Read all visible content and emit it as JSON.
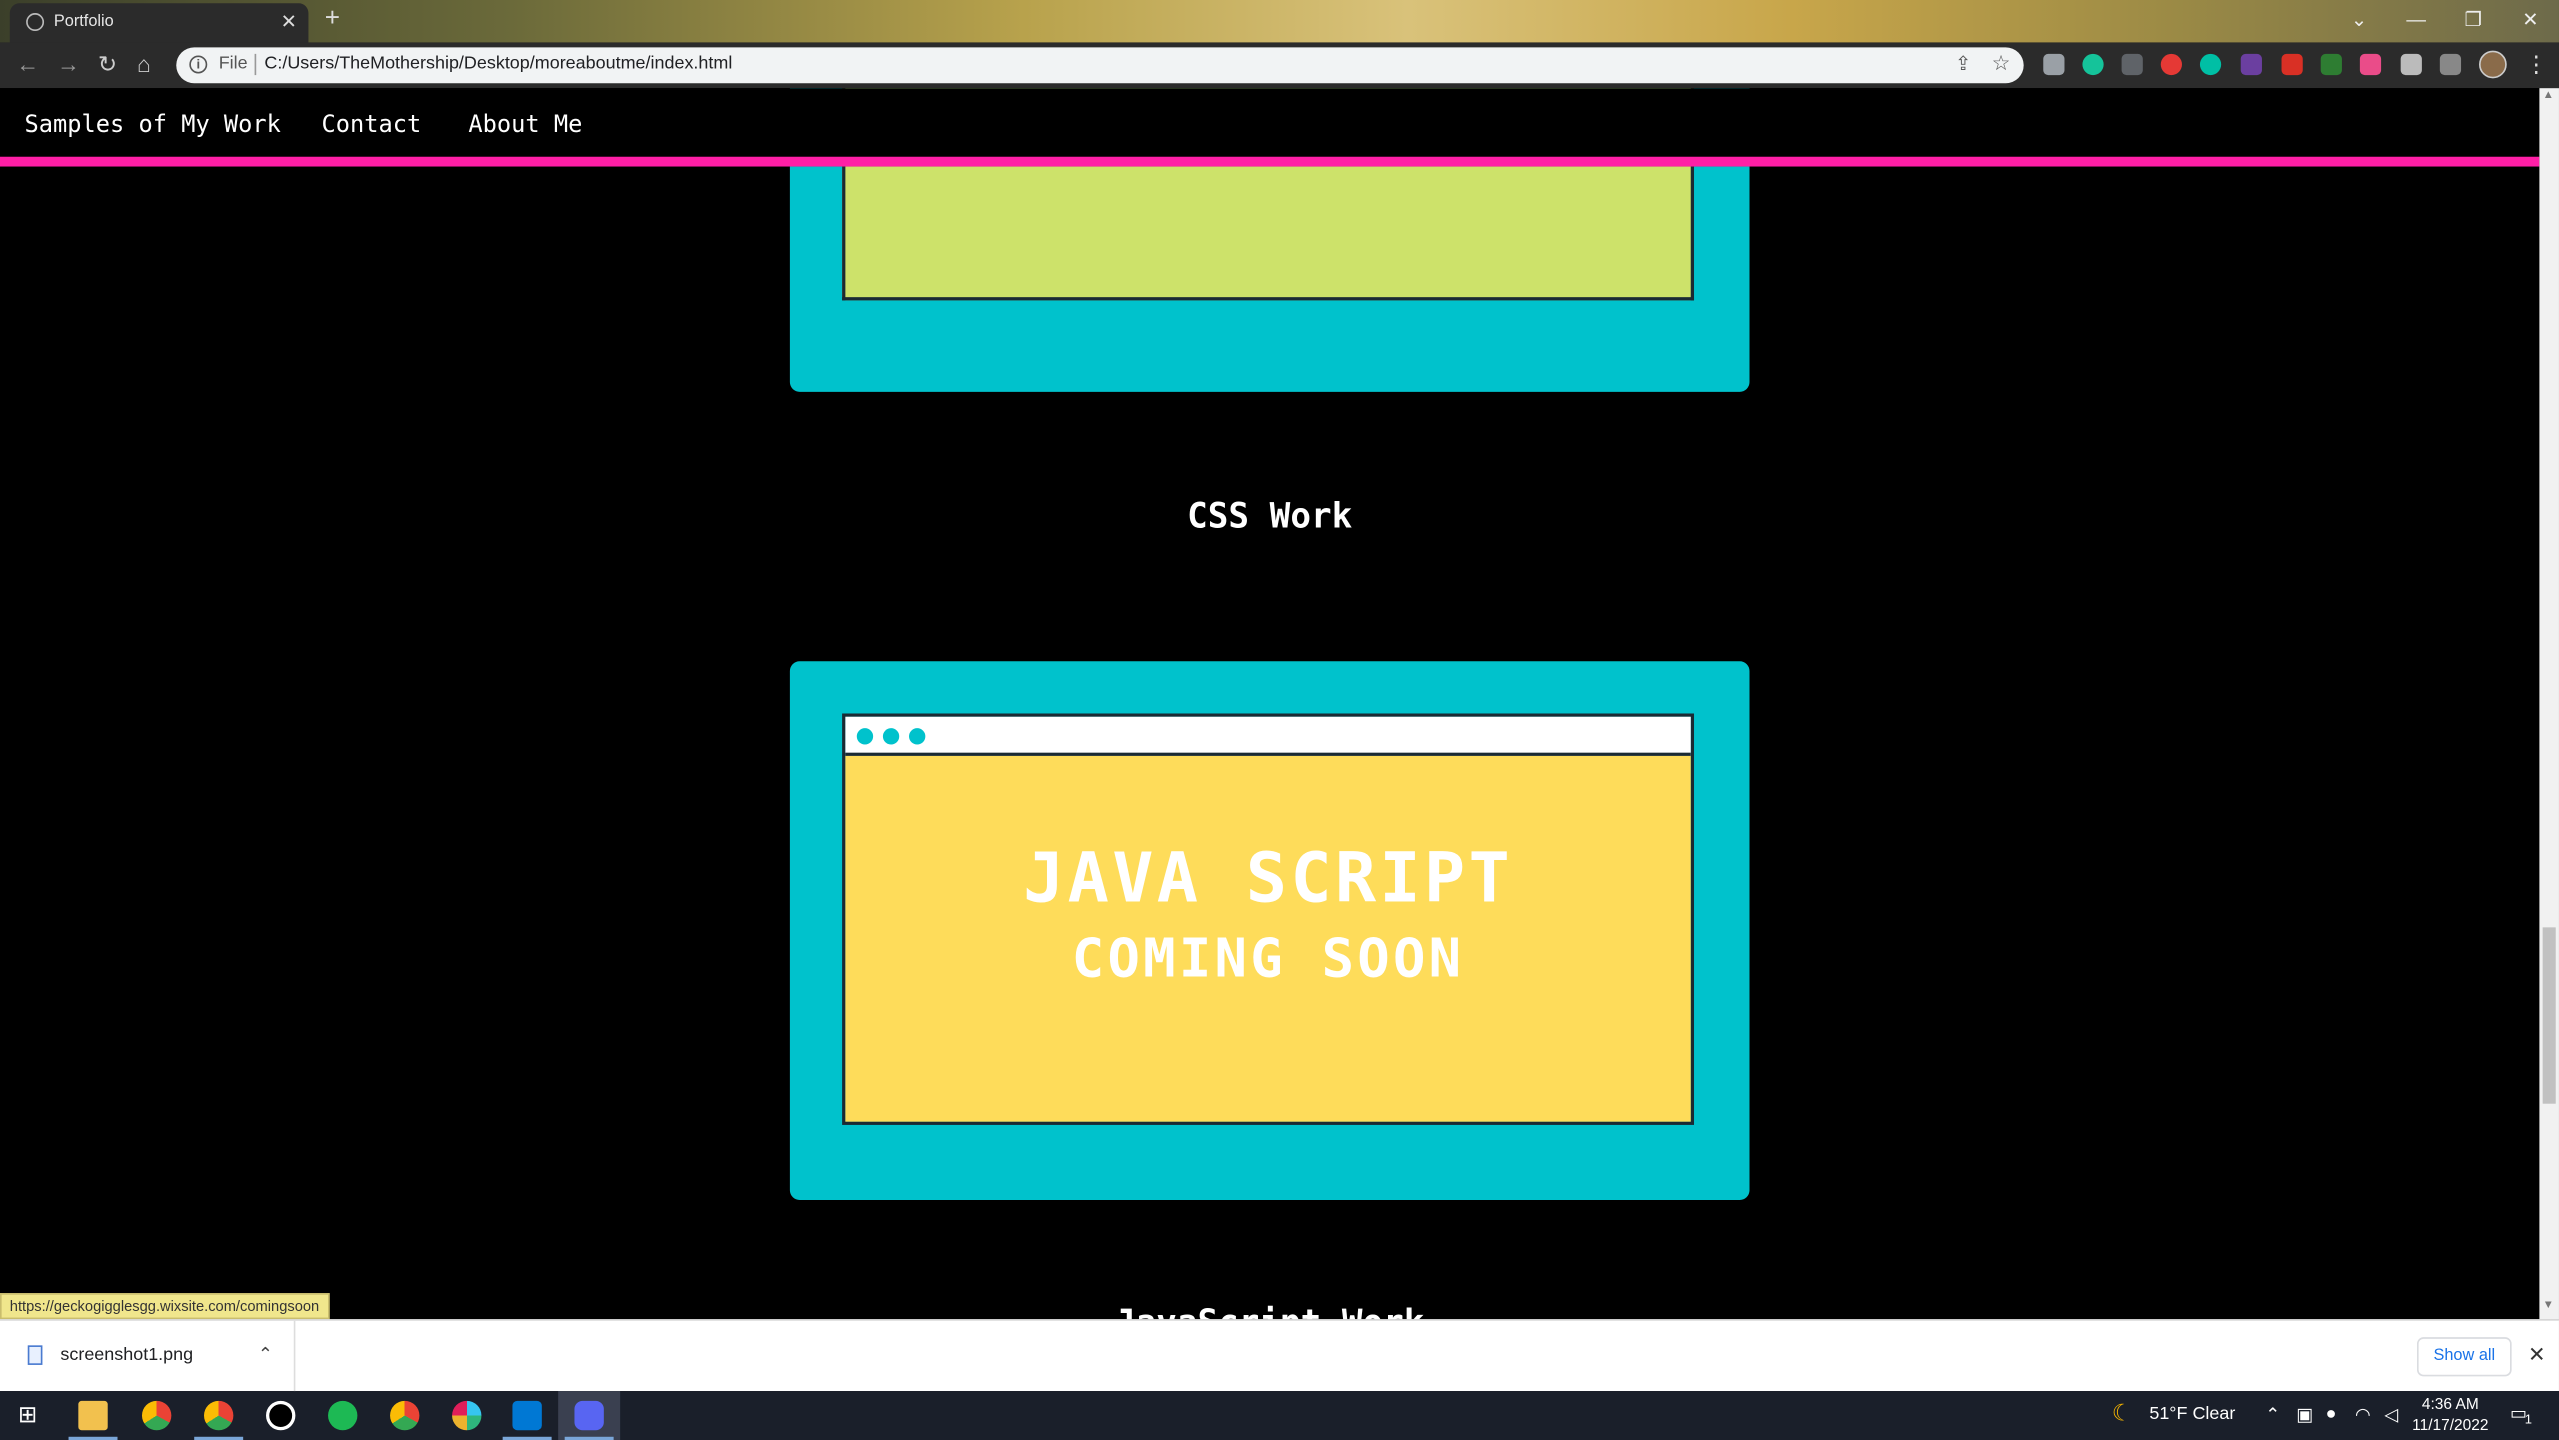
{
  "browser": {
    "tab_title": "Portfolio",
    "tab_close": "✕",
    "new_tab": "+",
    "url_scheme": "File",
    "url": "C:/Users/TheMothership/Desktop/moreaboutme/index.html",
    "window_controls": [
      "⌄",
      "—",
      "❐",
      "✕"
    ]
  },
  "site": {
    "nav": [
      "Samples of My Work",
      "Contact",
      "About Me"
    ],
    "section_css_title": "CSS Work",
    "js_card": {
      "line1": "JAVA SCRIPT",
      "line2": "COMING SOON"
    },
    "next_section_title_partial": "JavaScript Work"
  },
  "status_bar": {
    "link": "https://geckogigglesgg.wixsite.com/comingsoon"
  },
  "downloads": {
    "file_name": "screenshot1.png",
    "show_all": "Show all"
  },
  "taskbar": {
    "weather": "51°F  Clear",
    "time": "4:36 AM",
    "date": "11/17/2022",
    "notifications": "1"
  },
  "colors": {
    "nav_underline": "#ff1fa6",
    "card_teal": "#00c2cc",
    "screen_green": "#cde26a",
    "screen_yellow": "#fedc5a"
  }
}
